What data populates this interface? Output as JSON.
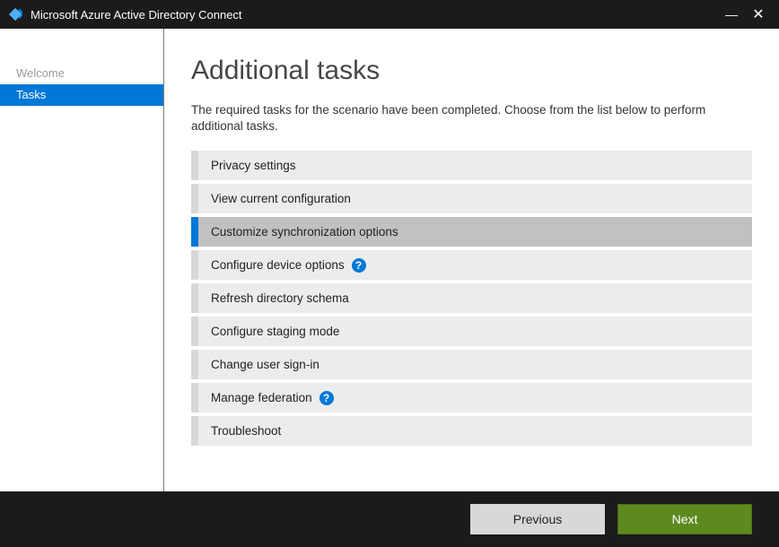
{
  "window": {
    "title": "Microsoft Azure Active Directory Connect"
  },
  "sidebar": {
    "items": [
      {
        "label": "Welcome",
        "state": "dim"
      },
      {
        "label": "Tasks",
        "state": "active"
      }
    ]
  },
  "main": {
    "heading": "Additional tasks",
    "description": "The required tasks for the scenario have been completed. Choose from the list below to perform additional tasks.",
    "tasks": [
      {
        "label": "Privacy settings",
        "selected": false,
        "help": false
      },
      {
        "label": "View current configuration",
        "selected": false,
        "help": false
      },
      {
        "label": "Customize synchronization options",
        "selected": true,
        "help": false
      },
      {
        "label": "Configure device options",
        "selected": false,
        "help": true
      },
      {
        "label": "Refresh directory schema",
        "selected": false,
        "help": false
      },
      {
        "label": "Configure staging mode",
        "selected": false,
        "help": false
      },
      {
        "label": "Change user sign-in",
        "selected": false,
        "help": false
      },
      {
        "label": "Manage federation",
        "selected": false,
        "help": true
      },
      {
        "label": "Troubleshoot",
        "selected": false,
        "help": false
      }
    ]
  },
  "footer": {
    "previous": "Previous",
    "next": "Next"
  },
  "icons": {
    "help": "?"
  }
}
